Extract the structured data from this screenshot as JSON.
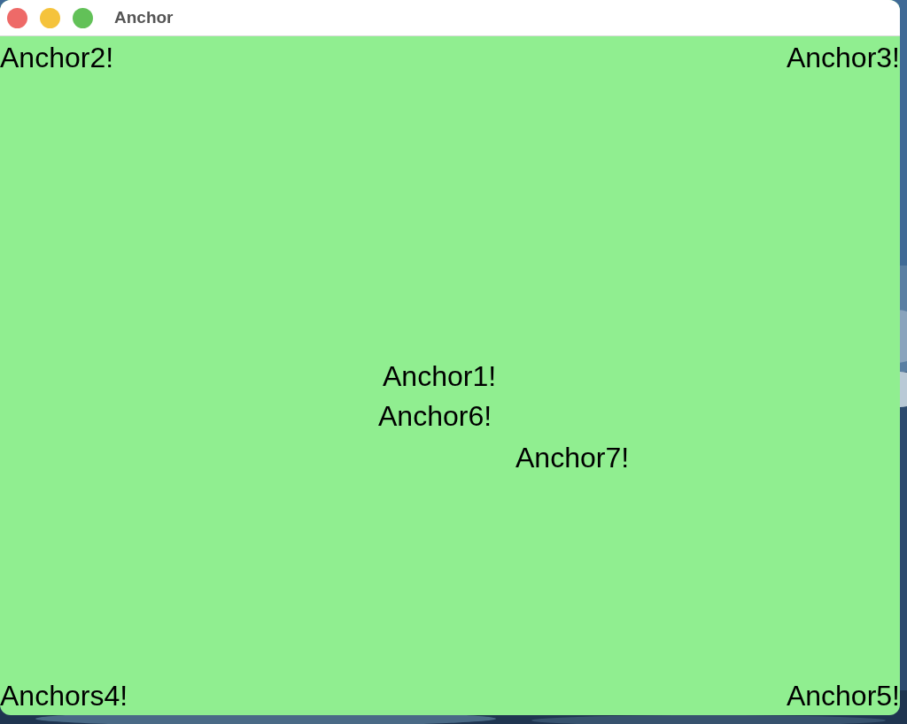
{
  "window": {
    "title": "Anchor"
  },
  "labels": [
    "Anchor2!",
    "Anchor3!",
    "Anchor1!",
    "Anchor6!",
    "Anchor7!",
    "Anchors4!",
    "Anchor5!"
  ]
}
